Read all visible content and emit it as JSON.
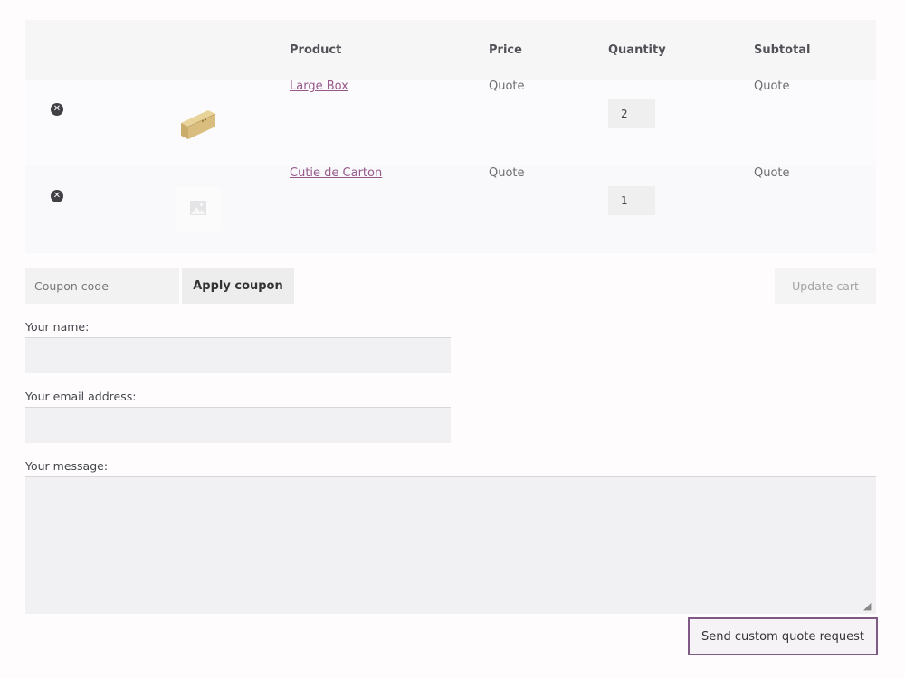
{
  "table": {
    "headers": {
      "product": "Product",
      "price": "Price",
      "quantity": "Quantity",
      "subtotal": "Subtotal"
    },
    "rows": [
      {
        "name": "Large Box",
        "price": "Quote",
        "quantity": "2",
        "subtotal": "Quote",
        "thumbnail": "wooden-box-image"
      },
      {
        "name": "Cutie de Carton",
        "price": "Quote",
        "quantity": "1",
        "subtotal": "Quote",
        "thumbnail": "placeholder-image-icon"
      }
    ]
  },
  "coupon": {
    "placeholder": "Coupon code",
    "apply_label": "Apply coupon"
  },
  "update_cart_label": "Update cart",
  "form": {
    "name_label": "Your name:",
    "email_label": "Your email address:",
    "message_label": "Your message:",
    "submit_label": "Send custom quote request"
  },
  "colors": {
    "link": "#96588a",
    "submit_border": "#7f5a85"
  }
}
